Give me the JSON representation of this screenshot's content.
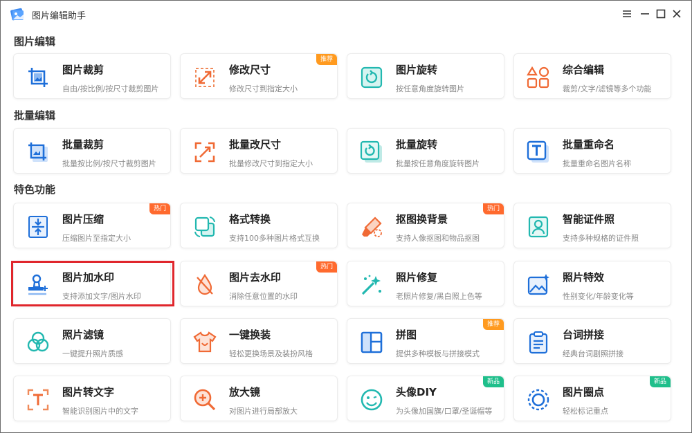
{
  "window": {
    "title": "图片编辑助手"
  },
  "sections": {
    "edit": "图片编辑",
    "batch": "批量编辑",
    "features": "特色功能"
  },
  "cards": {
    "crop": {
      "title": "图片裁剪",
      "desc": "自由/按比例/按尺寸裁剪图片"
    },
    "resize": {
      "title": "修改尺寸",
      "desc": "修改尺寸到指定大小",
      "badge": "推荐"
    },
    "rotate": {
      "title": "图片旋转",
      "desc": "按任意角度旋转图片"
    },
    "compedit": {
      "title": "综合编辑",
      "desc": "裁剪/文字/滤镜等多个功能"
    },
    "batch_crop": {
      "title": "批量裁剪",
      "desc": "批量按比例/按尺寸裁剪图片"
    },
    "batch_resize": {
      "title": "批量改尺寸",
      "desc": "批量修改尺寸到指定大小"
    },
    "batch_rotate": {
      "title": "批量旋转",
      "desc": "批量按任意角度旋转图片"
    },
    "batch_rename": {
      "title": "批量重命名",
      "desc": "批量重命名图片名称"
    },
    "compress": {
      "title": "图片压缩",
      "desc": "压缩图片至指定大小",
      "badge": "热门"
    },
    "convert": {
      "title": "格式转换",
      "desc": "支持100多种图片格式互换"
    },
    "cutout": {
      "title": "抠图换背景",
      "desc": "支持人像抠图和物品抠图",
      "badge": "热门"
    },
    "idphoto": {
      "title": "智能证件照",
      "desc": "支持多种规格的证件照"
    },
    "watermark_add": {
      "title": "图片加水印",
      "desc": "支持添加文字/图片水印"
    },
    "watermark_remove": {
      "title": "图片去水印",
      "desc": "消除任意位置的水印",
      "badge": "热门"
    },
    "repair": {
      "title": "照片修复",
      "desc": "老照片修复/黑白照上色等"
    },
    "effects": {
      "title": "照片特效",
      "desc": "性别变化/年龄变化等"
    },
    "filter": {
      "title": "照片滤镜",
      "desc": "一键提升照片质感"
    },
    "outfit": {
      "title": "一键换装",
      "desc": "轻松更换场景及装扮风格"
    },
    "collage": {
      "title": "拼图",
      "desc": "提供多种模板与拼接模式",
      "badge": "推荐"
    },
    "lines": {
      "title": "台词拼接",
      "desc": "经典台词剧照拼接"
    },
    "ocr": {
      "title": "图片转文字",
      "desc": "智能识别图片中的文字"
    },
    "magnifier": {
      "title": "放大镜",
      "desc": "对图片进行局部放大"
    },
    "avatar": {
      "title": "头像DIY",
      "desc": "为头像加国旗/口罩/圣诞帽等",
      "badge": "新品"
    },
    "circle": {
      "title": "图片圈点",
      "desc": "轻松标记重点",
      "badge": "新品"
    }
  },
  "icons": {
    "app": "photo-app-icon",
    "menu": "menu-icon",
    "minimize": "minimize-icon",
    "maximize": "maximize-icon",
    "close": "close-icon"
  },
  "colors": {
    "blue": "#1e6fd9",
    "orange": "#f06a35",
    "teal": "#22b8b0",
    "hot_badge": "#ff6a2e",
    "rec_badge": "#ff9a1f",
    "new_badge": "#1fbf8b",
    "highlight": "#e0262c"
  }
}
